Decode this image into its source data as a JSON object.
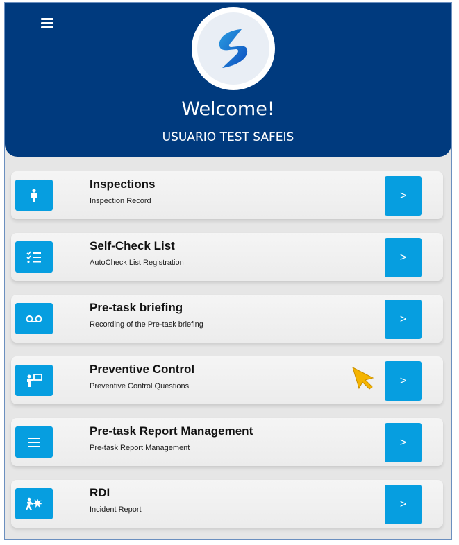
{
  "header": {
    "welcome": "Welcome!",
    "username": "USUARIO TEST SAFEIS",
    "background_color": "#003a7e",
    "menu_icon": "hamburger-menu-icon",
    "logo": "safeis-logo"
  },
  "menu": {
    "accent_color": "#069ee0",
    "items": [
      {
        "title": "Inspections",
        "subtitle": "Inspection Record",
        "icon": "person-icon",
        "button_label": ">"
      },
      {
        "title": "Self-Check List",
        "subtitle": "AutoCheck List Registration",
        "icon": "checklist-icon",
        "button_label": ">"
      },
      {
        "title": "Pre-task briefing",
        "subtitle": "Recording of the Pre-task briefing",
        "icon": "voicemail-icon",
        "button_label": ">"
      },
      {
        "title": "Preventive Control",
        "subtitle": "Preventive Control Questions",
        "icon": "presenter-icon",
        "button_label": ">"
      },
      {
        "title": "Pre-task Report Management",
        "subtitle": "Pre-task Report Management",
        "icon": "list-icon",
        "button_label": ">"
      },
      {
        "title": "RDI",
        "subtitle": "Incident Report",
        "icon": "injury-icon",
        "button_label": ">"
      }
    ]
  },
  "cursor": {
    "icon": "mouse-pointer-icon",
    "color": "#f5b400"
  }
}
